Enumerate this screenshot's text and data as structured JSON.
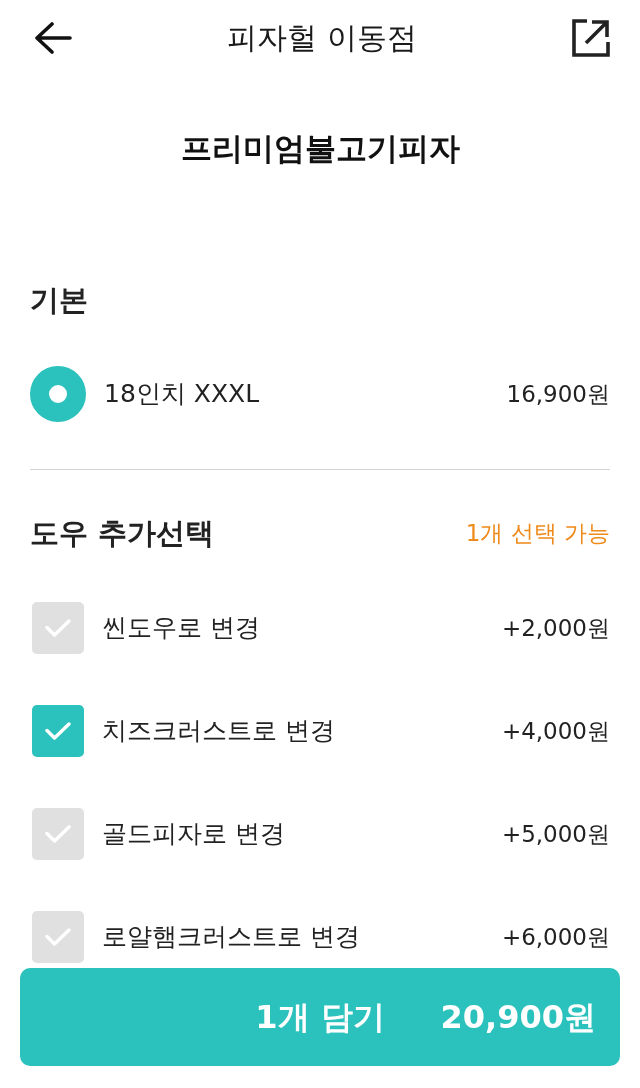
{
  "header": {
    "title": "피자헐 이동점"
  },
  "product": {
    "name": "프리미엄불고기피자"
  },
  "option_groups": [
    {
      "title": "기본",
      "kind": "radio",
      "options": [
        {
          "label": "18인치 XXXL",
          "price": "16,900원",
          "selected": true
        }
      ]
    },
    {
      "title": "도우 추가선택",
      "note": "1개 선택 가능",
      "kind": "checkbox",
      "options": [
        {
          "label": "씬도우로 변경",
          "price": "+2,000원",
          "checked": false
        },
        {
          "label": "치즈크러스트로 변경",
          "price": "+4,000원",
          "checked": true
        },
        {
          "label": "골드피자로 변경",
          "price": "+5,000원",
          "checked": false
        },
        {
          "label": "로얄햄크러스트로 변경",
          "price": "+6,000원",
          "checked": false
        }
      ]
    }
  ],
  "cart_button": {
    "label": "1개 담기",
    "total": "20,900원"
  }
}
